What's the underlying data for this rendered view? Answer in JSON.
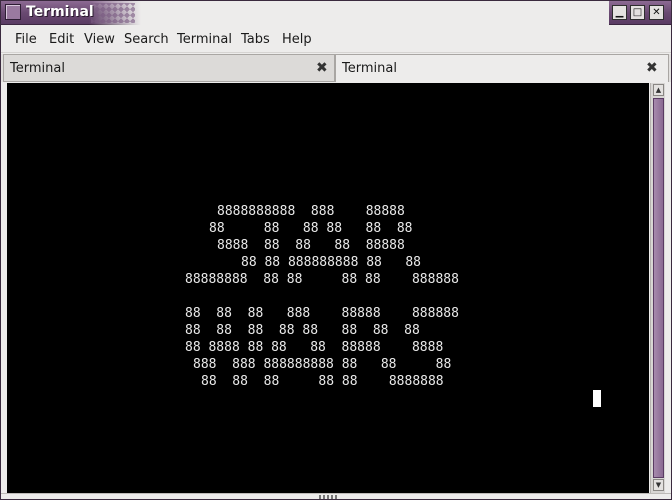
{
  "window": {
    "title": "Terminal",
    "buttons": {
      "minimize": "▁",
      "maximize": "□",
      "close": "✕"
    }
  },
  "menubar": {
    "items": [
      "File",
      "Edit",
      "View",
      "Search",
      "Terminal",
      "Tabs",
      "Help"
    ]
  },
  "tabs": [
    {
      "label": "Terminal",
      "close": "✖",
      "active": false
    },
    {
      "label": "Terminal",
      "close": "✖",
      "active": true
    }
  ],
  "terminal": {
    "lines": [
      "8888888888  888    88888",
      "88     88   88 88   88  88",
      "8888  88  88   88  88888",
      "88 88 888888888 88   88",
      "88888888  88 88     88 88    888888",
      "",
      "88  88  88   888    88888    888888",
      "88  88  88  88 88   88  88  88",
      "88 8888 88 88   88  88888    8888",
      "888  888 888888888 88   88     88",
      "88  88  88     88 88    8888888"
    ],
    "colors": {
      "background": "#000000",
      "foreground": "#e8e8e8"
    }
  },
  "scrollbar": {
    "up_arrow": "▲",
    "down_arrow": "▼"
  },
  "theme": {
    "accent": "#6a4a72"
  }
}
